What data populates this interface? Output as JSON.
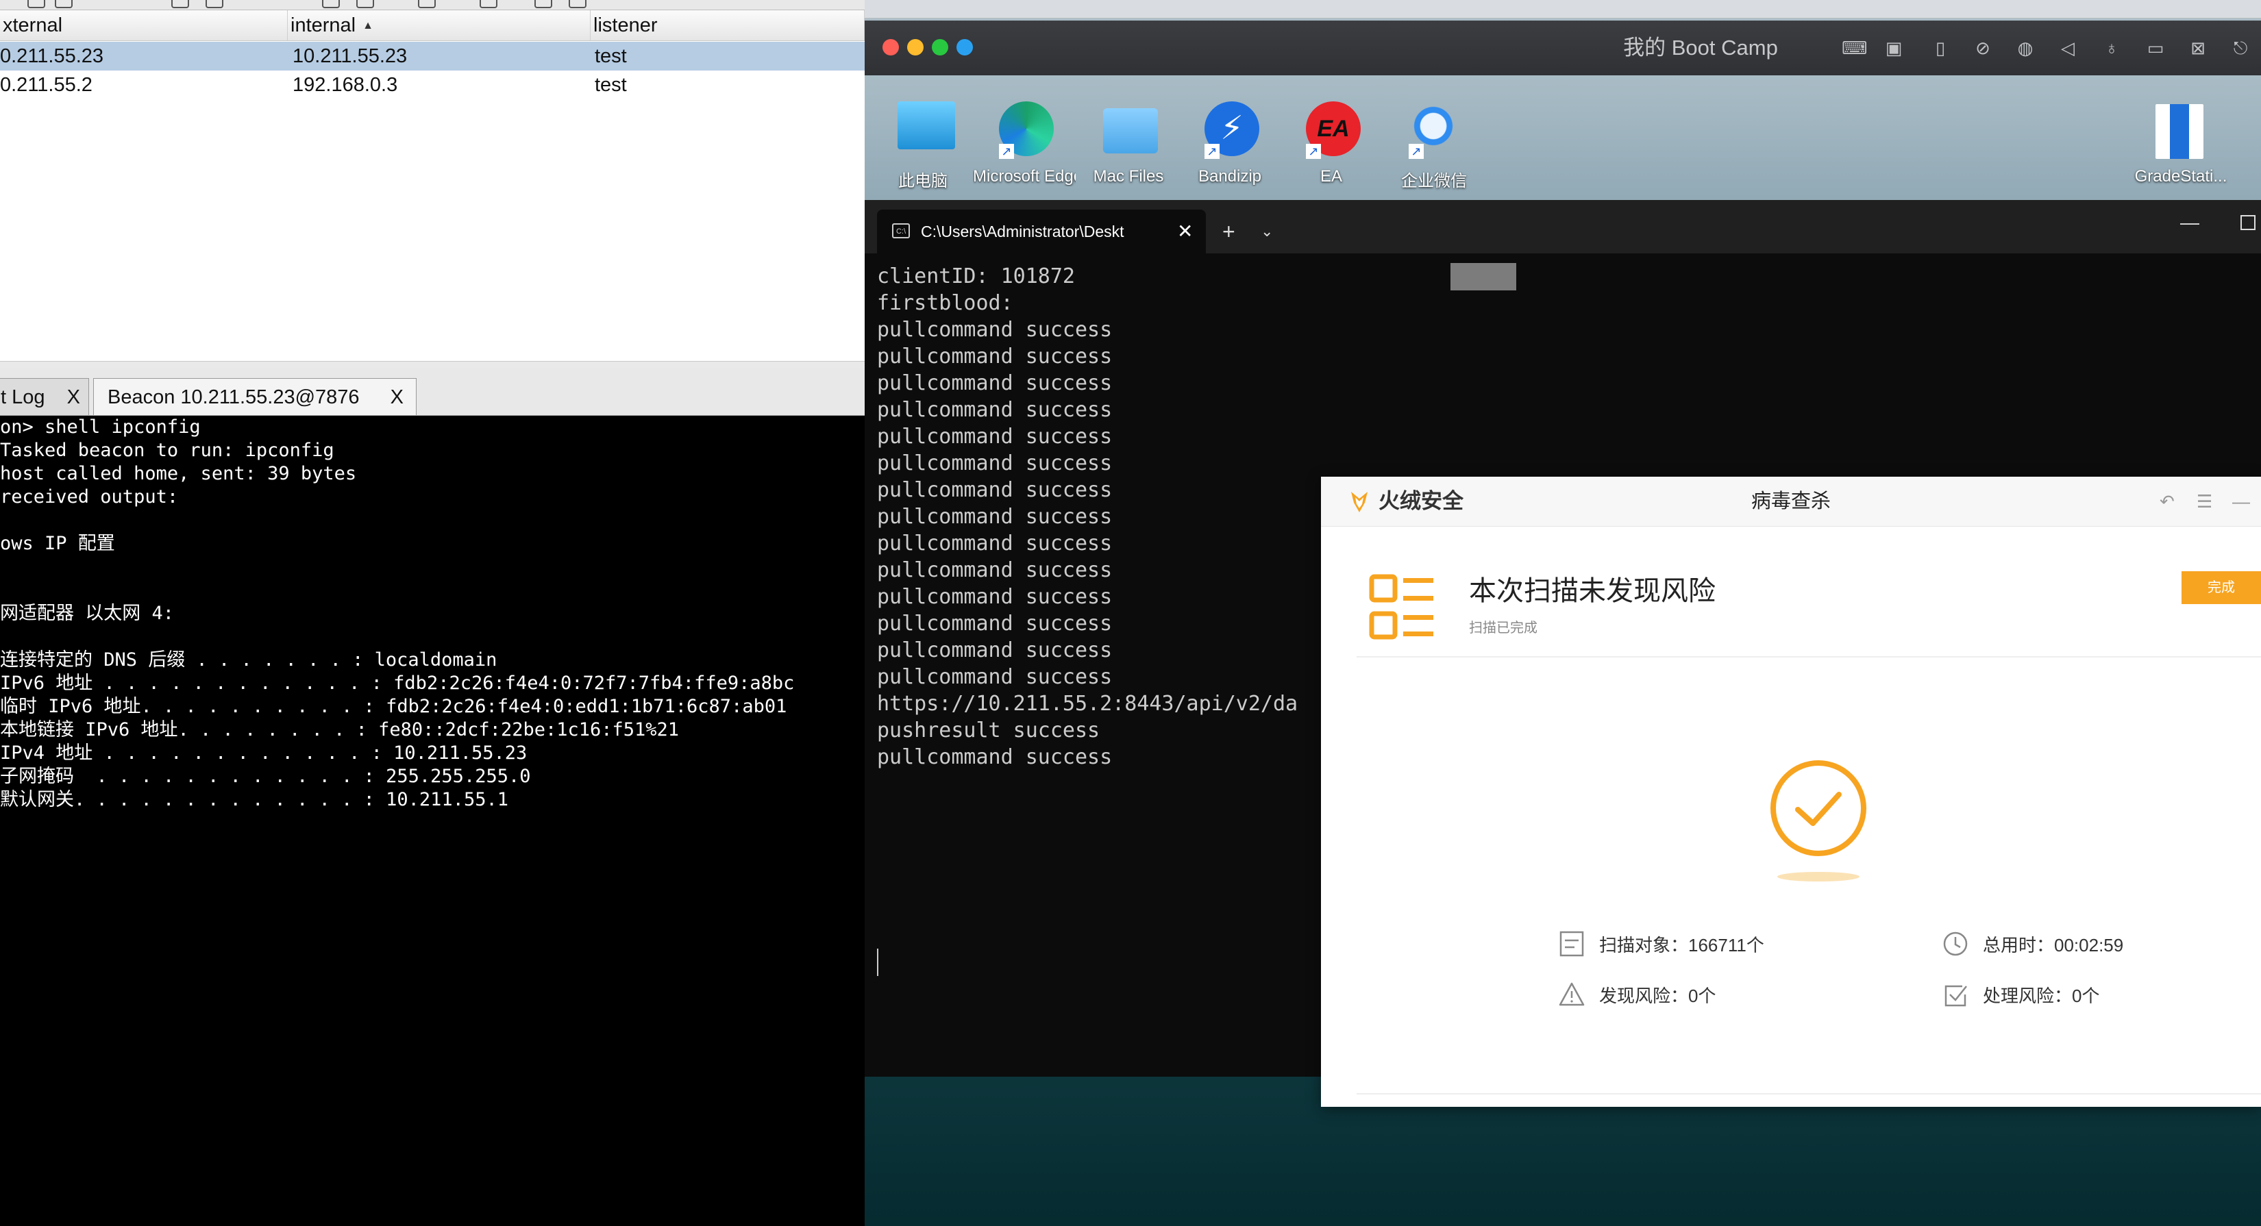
{
  "sessions": {
    "columns": [
      "xternal",
      "internal",
      "listener"
    ],
    "sort_indicator": "▲",
    "rows": [
      {
        "external": "0.211.55.23",
        "internal": "10.211.55.23",
        "listener": "test",
        "selected": true
      },
      {
        "external": "0.211.55.2",
        "internal": "192.168.0.3",
        "listener": "test",
        "selected": false
      }
    ]
  },
  "tabs": [
    {
      "label": "t Log",
      "close": "X"
    },
    {
      "label": "Beacon 10.211.55.23@7876",
      "close": "X"
    }
  ],
  "console_lines": [
    "on> shell ipconfig",
    "Tasked beacon to run: ipconfig",
    "host called home, sent: 39 bytes",
    "received output:",
    "",
    "ows IP 配置",
    "",
    "",
    "网适配器 以太网 4:",
    "",
    "连接特定的 DNS 后缀 . . . . . . . : localdomain",
    "IPv6 地址 . . . . . . . . . . . . : fdb2:2c26:f4e4:0:72f7:7fb4:ffe9:a8bc",
    "临时 IPv6 地址. . . . . . . . . . : fdb2:2c26:f4e4:0:edd1:1b71:6c87:ab01",
    "本地链接 IPv6 地址. . . . . . . . : fe80::2dcf:22be:1c16:f51%21",
    "IPv4 地址 . . . . . . . . . . . . : 10.211.55.23",
    "子网掩码  . . . . . . . . . . . . : 255.255.255.0",
    "默认网关. . . . . . . . . . . . . : 10.211.55.1"
  ],
  "vm": {
    "title": "我的 Boot Camp",
    "title_icons": [
      "keyboard-icon",
      "chip-icon",
      "usb-icon",
      "no-camera-icon",
      "globe-icon",
      "speaker-icon",
      "microphone-icon",
      "drive-icon",
      "camera-off-icon",
      "share-icon"
    ]
  },
  "desktop_icons": [
    {
      "label": "此电脑",
      "name": "this-pc-icon",
      "color": "#1e90d6"
    },
    {
      "label": "Microsoft Edge",
      "name": "edge-icon",
      "color": "#1aa06a"
    },
    {
      "label": "Mac Files",
      "name": "mac-files-icon",
      "color": "#4aa6e8"
    },
    {
      "label": "Bandizip",
      "name": "bandizip-icon",
      "color": "#1d6fe0"
    },
    {
      "label": "EA",
      "name": "ea-icon",
      "color": "#e8232a"
    },
    {
      "label": "企业微信",
      "name": "wecom-icon",
      "color": "#2f8cf0"
    },
    {
      "label": "GradeStati...",
      "name": "gradestats-icon",
      "color": "#1f6fd8"
    }
  ],
  "terminal": {
    "tab_title": "C:\\Users\\Administrator\\Deskt",
    "close": "✕",
    "plus": "+",
    "chevron": "⌄",
    "minimize": "—",
    "lines": [
      "clientID: 101872",
      "firstblood:",
      "pullcommand success",
      "pullcommand success",
      "pullcommand success",
      "pullcommand success",
      "pullcommand success",
      "pullcommand success",
      "pullcommand success",
      "pullcommand success",
      "pullcommand success",
      "pullcommand success",
      "pullcommand success",
      "pullcommand success",
      "pullcommand success",
      "pullcommand success",
      "https://10.211.55.2:8443/api/v2/da",
      "pushresult success",
      "pullcommand success"
    ]
  },
  "huorong": {
    "brand": "火绒安全",
    "center_title": "病毒查杀",
    "controls": [
      "↶",
      "☰",
      "—"
    ],
    "heading": "本次扫描未发现风险",
    "subheading": "扫描已完成",
    "done_button": "完成",
    "stats": {
      "scan_objects": "扫描对象：166711个",
      "total_time": "总用时：00:02:59",
      "found_risk": "发现风险：0个",
      "handled_risk": "处理风险：0个"
    },
    "accent": "#f7a421"
  },
  "colors": {
    "selected_row": "#b5cce3",
    "console_bg": "#000000",
    "terminal_bg": "#0c0c0c"
  }
}
